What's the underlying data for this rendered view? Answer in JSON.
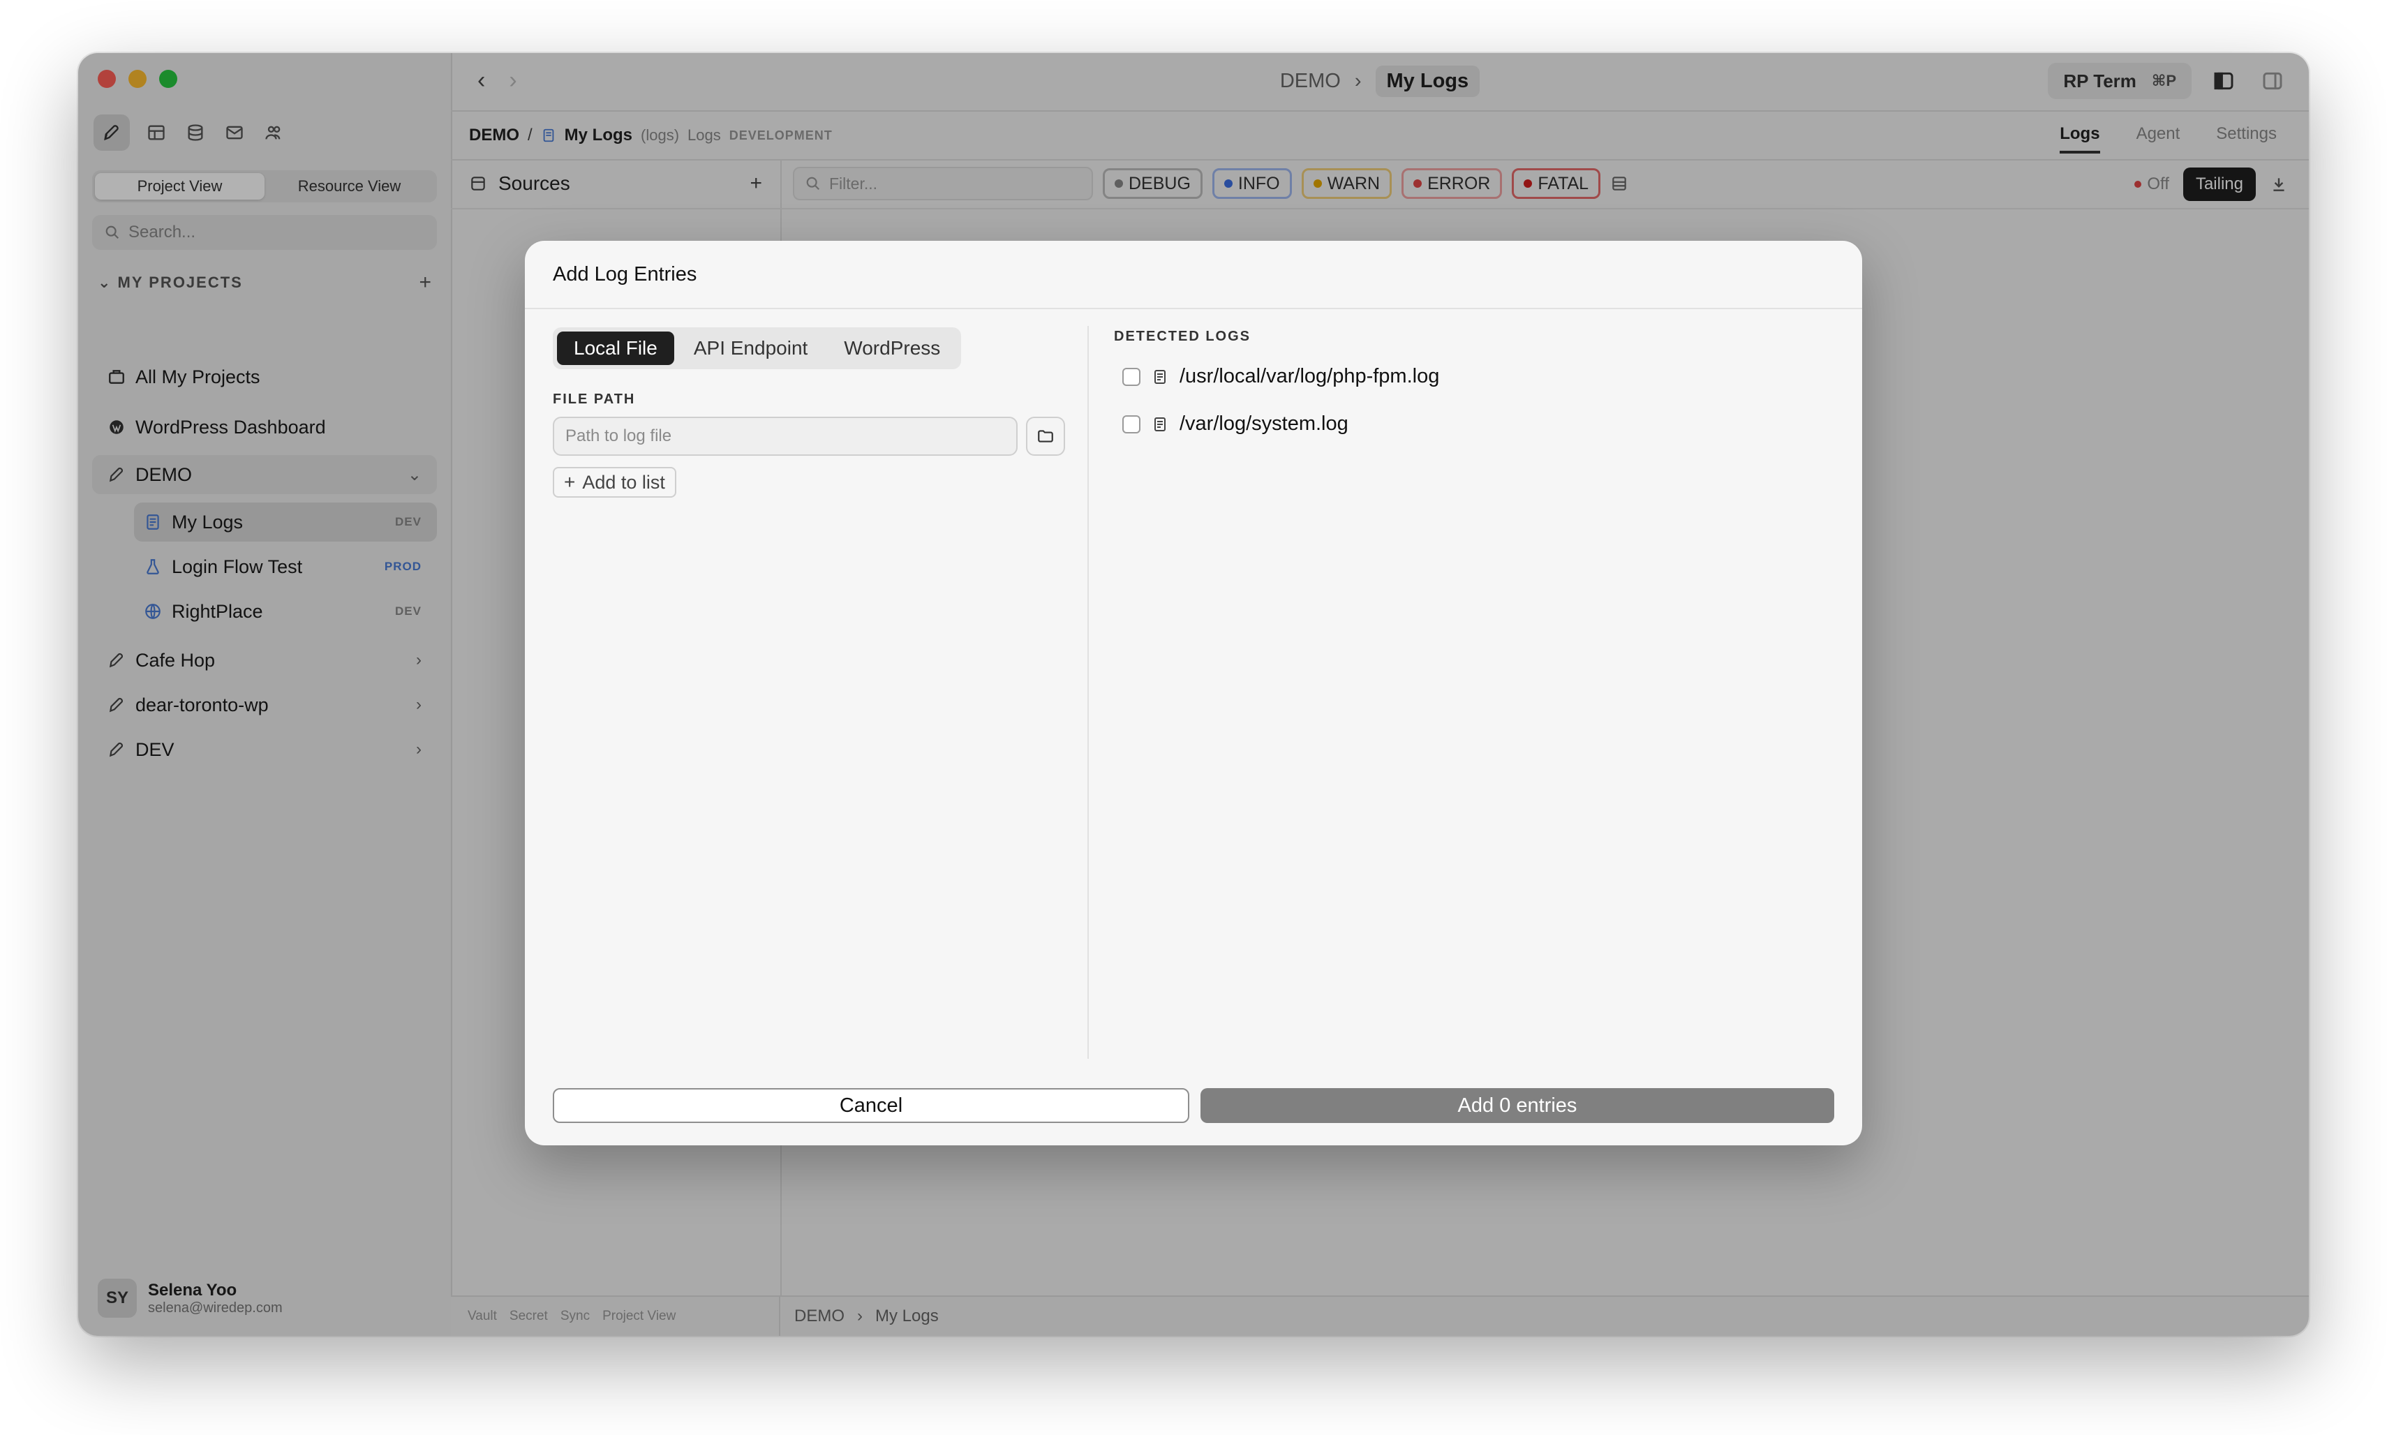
{
  "sidebar": {
    "view_tabs": [
      "Project View",
      "Resource View"
    ],
    "search_placeholder": "Search...",
    "section_title": "MY PROJECTS",
    "items": [
      {
        "label": "All My Projects"
      },
      {
        "label": "WordPress Dashboard"
      }
    ],
    "group": {
      "label": "DEMO"
    },
    "subitems": [
      {
        "label": "My Logs",
        "badge": "DEV"
      },
      {
        "label": "Login Flow Test",
        "badge": "PROD"
      },
      {
        "label": "RightPlace",
        "badge": "DEV"
      }
    ],
    "projects": [
      {
        "label": "Cafe Hop"
      },
      {
        "label": "dear-toronto-wp"
      },
      {
        "label": "DEV"
      }
    ],
    "user": {
      "initials": "SY",
      "name": "Selena Yoo",
      "email": "selena@wiredep.com"
    }
  },
  "titlebar": {
    "crumb_parent": "DEMO",
    "crumb_sep": "›",
    "crumb_current": "My Logs",
    "rp_term": "RP Term",
    "rp_term_shortcut": "⌘P"
  },
  "breadcrumb": {
    "project": "DEMO",
    "sep": "/",
    "resource": "My Logs",
    "type": "(logs)",
    "kind": "Logs",
    "env": "DEVELOPMENT"
  },
  "tabs": [
    "Logs",
    "Agent",
    "Settings"
  ],
  "sources": {
    "title": "Sources"
  },
  "filter": {
    "placeholder": "Filter...",
    "levels": [
      "DEBUG",
      "INFO",
      "WARN",
      "ERROR",
      "FATAL"
    ],
    "off_label": "Off",
    "tailing_label": "Tailing"
  },
  "statusbar": {
    "left": [
      "Vault",
      "Secret",
      "Sync",
      "Project View"
    ],
    "crumb_parent": "DEMO",
    "crumb_sep": "›",
    "crumb_current": "My Logs"
  },
  "modal": {
    "title": "Add Log Entries",
    "source_tabs": [
      "Local File",
      "API Endpoint",
      "WordPress"
    ],
    "file_path_label": "FILE PATH",
    "file_path_placeholder": "Path to log file",
    "file_path_value": "",
    "add_to_list": "Add to list",
    "detected_label": "DETECTED LOGS",
    "detected": [
      "/usr/local/var/log/php-fpm.log",
      "/var/log/system.log"
    ],
    "cancel": "Cancel",
    "add_button": "Add 0 entries"
  }
}
